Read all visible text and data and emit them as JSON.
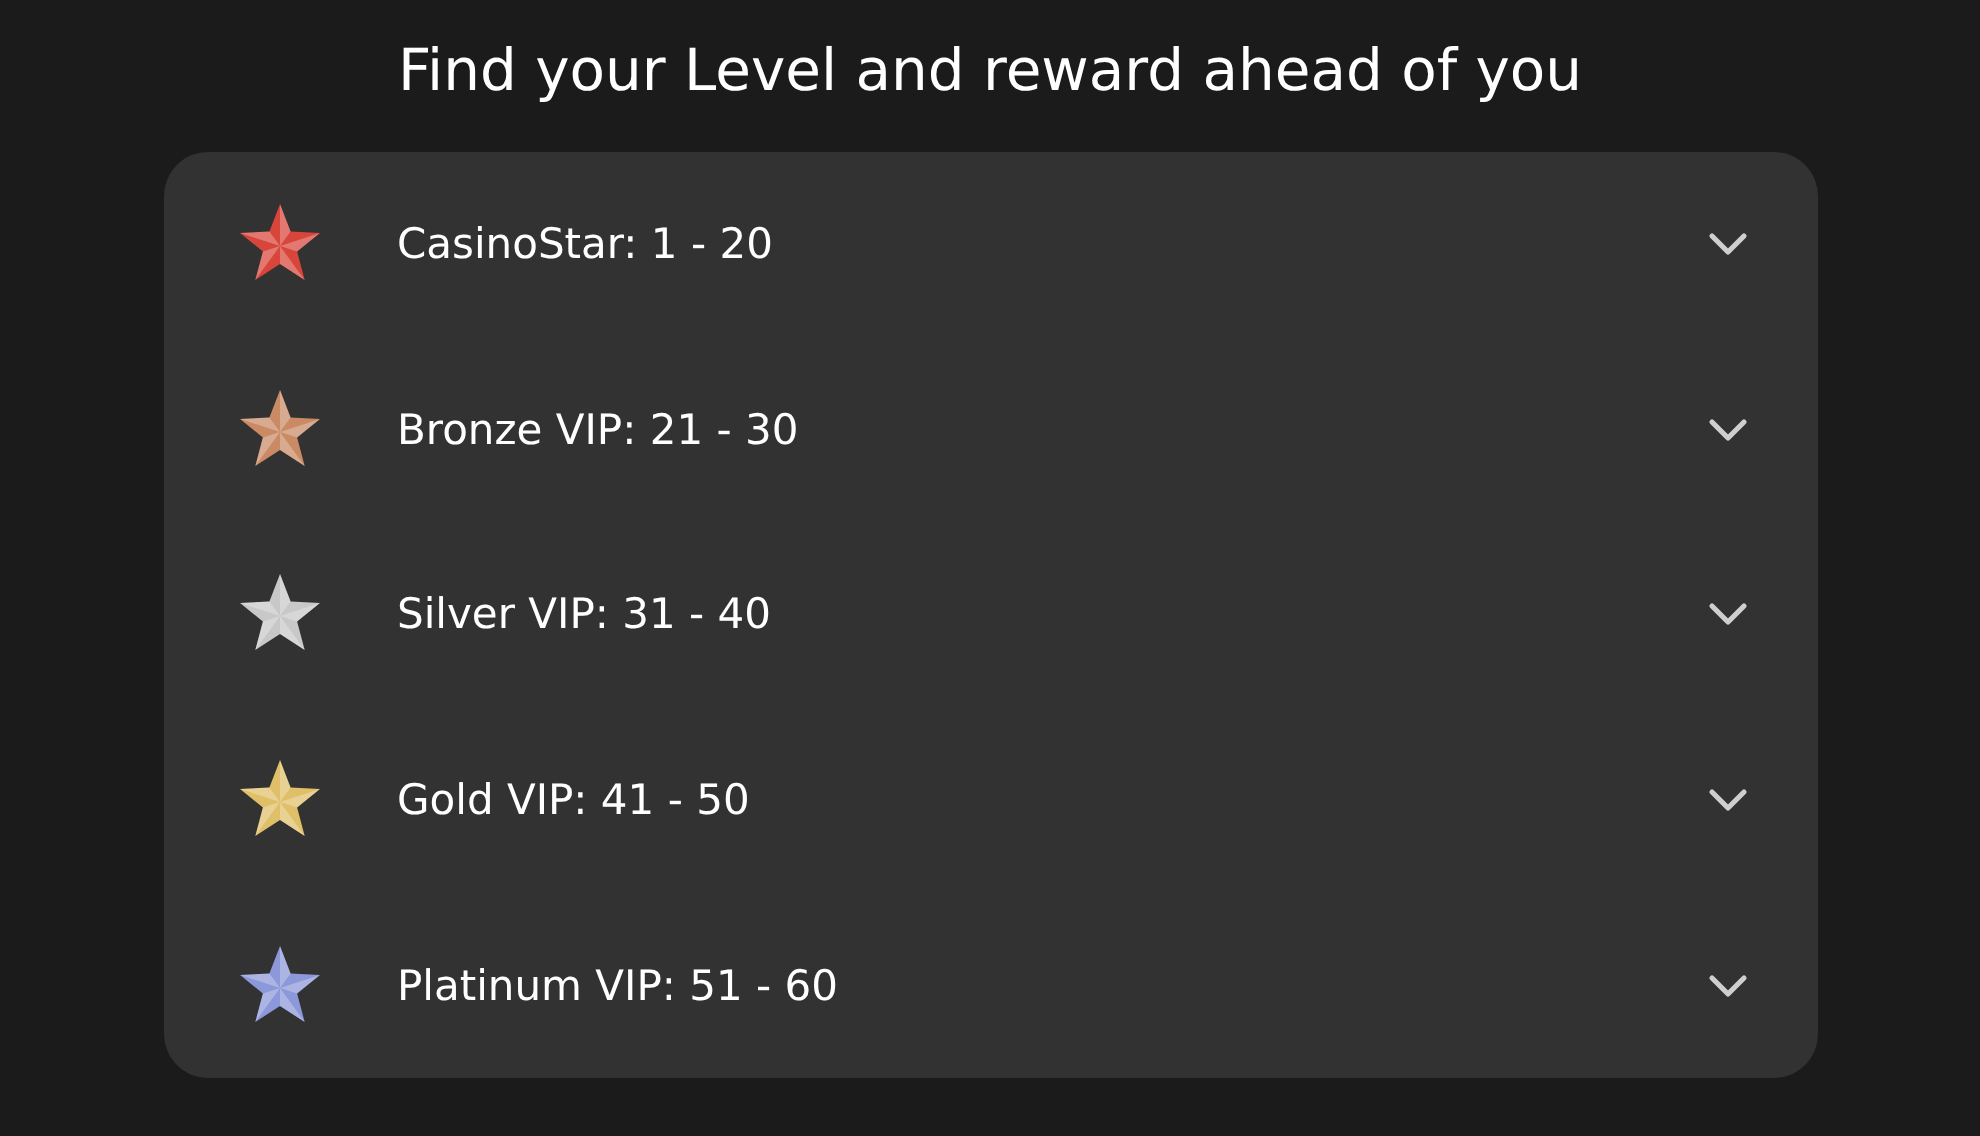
{
  "title": "Find your Level and reward ahead of you",
  "levels": [
    {
      "label": "CasinoStar: 1 - 20",
      "color": "#d8453a",
      "expanded": false
    },
    {
      "label": "Bronze VIP: 21 - 30",
      "color": "#c98a64",
      "expanded": false
    },
    {
      "label": "Silver VIP: 31 - 40",
      "color": "#c8c8c8",
      "expanded": false
    },
    {
      "label": "Gold VIP: 41 - 50",
      "color": "#dfbf68",
      "expanded": false
    },
    {
      "label": "Platinum VIP: 51 - 60",
      "color": "#8c98da",
      "expanded": false
    }
  ]
}
